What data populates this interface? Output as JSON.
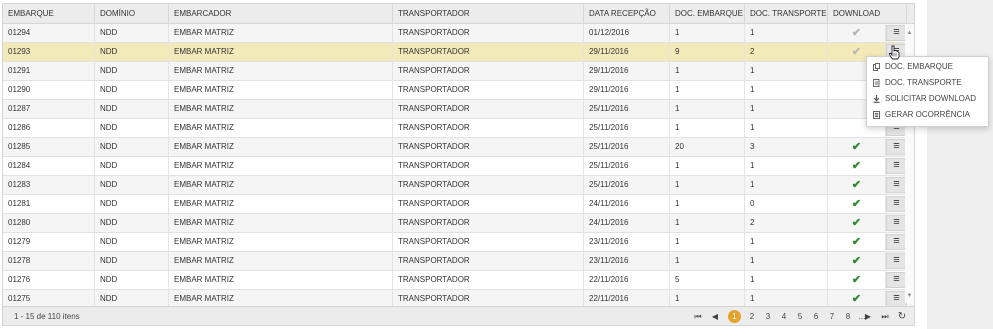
{
  "columns": {
    "embarque": "EMBARQUE",
    "dominio": "DOMÍNIO",
    "embarcador": "EMBARCADOR",
    "transportador": "TRANSPORTADOR",
    "data_recepcao": "DATA RECEPÇÃO",
    "doc_embarque": "DOC. EMBARQUE",
    "doc_transporte": "DOC. TRANSPORTE",
    "download": "DOWNLOAD"
  },
  "rows": [
    {
      "embarque": "01294",
      "dominio": "NDD",
      "embarcador": "EMBAR MATRIZ",
      "transportador": "TRANSPORTADOR",
      "data": "01/12/2016",
      "doc_embarque": "1",
      "doc_transporte": "1",
      "download": "✔"
    },
    {
      "embarque": "01293",
      "dominio": "NDD",
      "embarcador": "EMBAR MATRIZ",
      "transportador": "TRANSPORTADOR",
      "data": "29/11/2016",
      "doc_embarque": "9",
      "doc_transporte": "2",
      "download": "✔"
    },
    {
      "embarque": "01291",
      "dominio": "NDD",
      "embarcador": "EMBAR MATRIZ",
      "transportador": "TRANSPORTADOR",
      "data": "29/11/2016",
      "doc_embarque": "1",
      "doc_transporte": "1",
      "download": ""
    },
    {
      "embarque": "01290",
      "dominio": "NDD",
      "embarcador": "EMBAR MATRIZ",
      "transportador": "TRANSPORTADOR",
      "data": "29/11/2016",
      "doc_embarque": "1",
      "doc_transporte": "1",
      "download": ""
    },
    {
      "embarque": "01287",
      "dominio": "NDD",
      "embarcador": "EMBAR MATRIZ",
      "transportador": "TRANSPORTADOR",
      "data": "25/11/2016",
      "doc_embarque": "1",
      "doc_transporte": "1",
      "download": ""
    },
    {
      "embarque": "01286",
      "dominio": "NDD",
      "embarcador": "EMBAR MATRIZ",
      "transportador": "TRANSPORTADOR",
      "data": "25/11/2016",
      "doc_embarque": "1",
      "doc_transporte": "1",
      "download": ""
    },
    {
      "embarque": "01285",
      "dominio": "NDD",
      "embarcador": "EMBAR MATRIZ",
      "transportador": "TRANSPORTADOR",
      "data": "25/11/2016",
      "doc_embarque": "20",
      "doc_transporte": "3",
      "download": "✔"
    },
    {
      "embarque": "01284",
      "dominio": "NDD",
      "embarcador": "EMBAR MATRIZ",
      "transportador": "TRANSPORTADOR",
      "data": "25/11/2016",
      "doc_embarque": "1",
      "doc_transporte": "1",
      "download": "✔"
    },
    {
      "embarque": "01283",
      "dominio": "NDD",
      "embarcador": "EMBAR MATRIZ",
      "transportador": "TRANSPORTADOR",
      "data": "25/11/2016",
      "doc_embarque": "1",
      "doc_transporte": "1",
      "download": "✔"
    },
    {
      "embarque": "01281",
      "dominio": "NDD",
      "embarcador": "EMBAR MATRIZ",
      "transportador": "TRANSPORTADOR",
      "data": "24/11/2016",
      "doc_embarque": "1",
      "doc_transporte": "0",
      "download": "✔"
    },
    {
      "embarque": "01280",
      "dominio": "NDD",
      "embarcador": "EMBAR MATRIZ",
      "transportador": "TRANSPORTADOR",
      "data": "24/11/2016",
      "doc_embarque": "1",
      "doc_transporte": "2",
      "download": "✔"
    },
    {
      "embarque": "01279",
      "dominio": "NDD",
      "embarcador": "EMBAR MATRIZ",
      "transportador": "TRANSPORTADOR",
      "data": "23/11/2016",
      "doc_embarque": "1",
      "doc_transporte": "1",
      "download": "✔"
    },
    {
      "embarque": "01278",
      "dominio": "NDD",
      "embarcador": "EMBAR MATRIZ",
      "transportador": "TRANSPORTADOR",
      "data": "23/11/2016",
      "doc_embarque": "1",
      "doc_transporte": "1",
      "download": "✔"
    },
    {
      "embarque": "01276",
      "dominio": "NDD",
      "embarcador": "EMBAR MATRIZ",
      "transportador": "TRANSPORTADOR",
      "data": "22/11/2016",
      "doc_embarque": "5",
      "doc_transporte": "1",
      "download": "✔"
    },
    {
      "embarque": "01275",
      "dominio": "NDD",
      "embarcador": "EMBAR MATRIZ",
      "transportador": "TRANSPORTADOR",
      "data": "22/11/2016",
      "doc_embarque": "1",
      "doc_transporte": "1",
      "download": "✔"
    }
  ],
  "selected_row": 1,
  "dim_check_rows": [
    0,
    1
  ],
  "menu_glyph": "≡",
  "pager": {
    "info": "1 - 15 de 110 itens",
    "first": "⏮",
    "prev": "◀",
    "pages": [
      "1",
      "2",
      "3",
      "4",
      "5",
      "6",
      "7",
      "8"
    ],
    "more": "...",
    "current": "1",
    "next": "▶",
    "last": "⏭",
    "refresh": "↻"
  },
  "context_menu": {
    "items": [
      {
        "label": "DOC. EMBARQUE",
        "icon": "document-stack-icon"
      },
      {
        "label": "DOC. TRANSPORTE",
        "icon": "document-icon"
      },
      {
        "label": "SOLICITAR DOWNLOAD",
        "icon": "download-icon"
      },
      {
        "label": "GERAR OCORRÊNCIA",
        "icon": "report-icon"
      }
    ]
  },
  "colors": {
    "selected_row": "#f3eab9",
    "accent": "#e6a32a",
    "check": "#2d8a2d"
  }
}
